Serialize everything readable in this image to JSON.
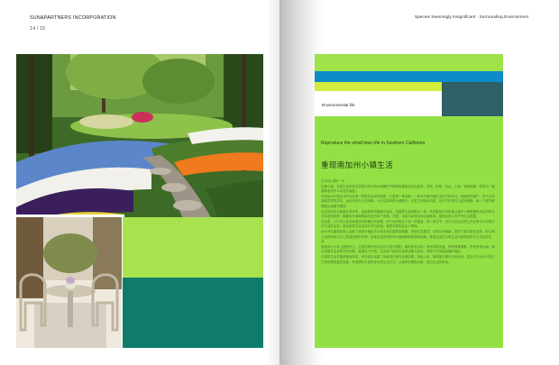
{
  "header": {
    "brand": "SUN&PARTNERS INCORPORATION",
    "page_number": "14 / 15",
    "chapter_title": "Species Seemingly Insignificant · Surrounding Environment"
  },
  "right_page": {
    "section_label": "Environmental life",
    "subtitle": "Reproduce the small town life in Southern California",
    "heading": "重现南加州小镇生活",
    "body": [
      "文/项目 资料一号",
      "在那小镇，宜居生活的信念总能与阳光雨水和暖的气候等因素相互结合起来，宅院、街巷、花丛、小溪，相映成趣，构筑出一幅幅简洁而令人向往的画面。",
      "在南加州小镇生活不仅仅是一种居住空间的感受，它更是一种态度，一种对于慢节奏生活方式的向往。清晨推开窗户，空气中弥漫着花草的芬芳，远处传来鸟儿的鸣唱，人们沿着林荫小道散步，邻里之间亲切问候，孩子们在草坪上嬉戏奔跑，每一个细节都透露出温暖与惬意。",
      "社区规划充分尊重自然环境，保留原有的植被与地形，将建筑与景观融为一体。低密度的住宅布局让每户人家都拥有充足的阳光与私密的庭院，蜿蜒的步道串联起社区的各个角落，花园、水景与休憩空间点缀其间，营造出宜人的户外生活氛围。",
      "在这里，人们可以在自家庭院中种植花卉蔬果，在午后的阳光下品一杯香茗，读一本好书；也可以在社区的公共空间中与邻居分享生活的点滴，参加各类文化活动与节日庆典，感受浓厚的社区人情味。",
      "设计师在建筑风格上汲取了西班牙殖民式与地中海式建筑的精髓，采用红瓦屋顶、白色灰泥墙面、拱形门窗与铁艺装饰，配以陶土色的地砖与手工质感的细节处理，呈现出温润质朴而又典雅精致的建筑面貌，使居住者在日常生活中感受到历史与文化的沉淀。",
      "景观设计以本土植物为主，注重四季的色彩变化与层次搭配，春有繁花似锦，夏有绿荫如盖，秋有硕果累累，冬有常青点缀。雨水花园与生态草沟的设置，既美化了环境，又实现了雨水的自然收集与净化，体现了可持续发展的理念。",
      "小镇的生活节奏舒缓而有序，商业街区保留了传统的尺度与街道肌理，特色小店、咖啡馆与餐厅沿街而设，居民们可以步行抵达日常所需的各类设施，享受便利与悠闲并存的生活方式，让城市的喧嚣远离，回归生活的本真。"
    ]
  }
}
